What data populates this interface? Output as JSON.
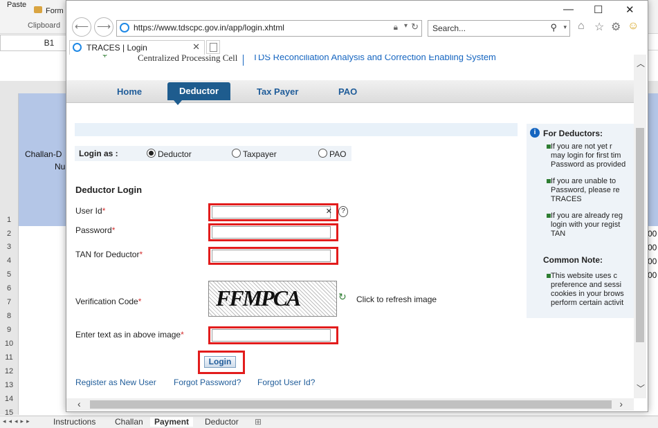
{
  "excel": {
    "ribbon": {
      "paste": "Paste",
      "format": "Form",
      "clipboard": "Clipboard"
    },
    "namebox": "B1",
    "row_numbers": [
      "1",
      "2",
      "3",
      "4",
      "5",
      "6",
      "7",
      "8",
      "9",
      "10",
      "11",
      "12",
      "13",
      "14",
      "15"
    ],
    "cell_a1_line1": "Challan-D",
    "cell_a1_line2": "Nu",
    "right_values": [
      "00",
      "00",
      "00",
      "00"
    ],
    "sheet_tabs": [
      "Instructions",
      "Challan",
      "Payment",
      "Deductor"
    ],
    "active_sheet": "Payment"
  },
  "browser": {
    "url": "https://www.tdscpc.gov.in/app/login.xhtml",
    "search_placeholder": "Search...",
    "tab_title": "TRACES | Login"
  },
  "site": {
    "cpc_text": "Centralized Processing Cell",
    "full_name": "TDS Reconciliation Analysis and Correction Enabling System",
    "nav": [
      "Home",
      "Deductor",
      "Tax Payer",
      "PAO"
    ],
    "active_nav": "Deductor"
  },
  "login": {
    "login_as_label": "Login as :",
    "options": [
      "Deductor",
      "Taxpayer",
      "PAO"
    ],
    "selected": "Deductor",
    "heading": "Deductor Login",
    "fields": {
      "user_id": "User Id",
      "password": "Password",
      "tan": "TAN for Deductor",
      "verification": "Verification Code",
      "captcha_text": "Enter text as in above image"
    },
    "required_marker": "*",
    "captcha_image_text": "FFMPCA",
    "refresh_text": "Click to refresh image",
    "login_button": "Login",
    "help_glyph": "?",
    "links": [
      "Register as New User",
      "Forgot Password?",
      "Forgot User Id?"
    ]
  },
  "sidebar": {
    "heading": "For Deductors:",
    "items": [
      "If you are not yet r\nmay login for first tim\nPassword as provided",
      "If you are unable to\nPassword, please re\nTRACES",
      "If you are already reg\nlogin with your regist\nTAN"
    ],
    "note_heading": "Common Note:",
    "note_item": "This website uses c\npreference and sessi\ncookies in your brows\nperform certain activit"
  }
}
